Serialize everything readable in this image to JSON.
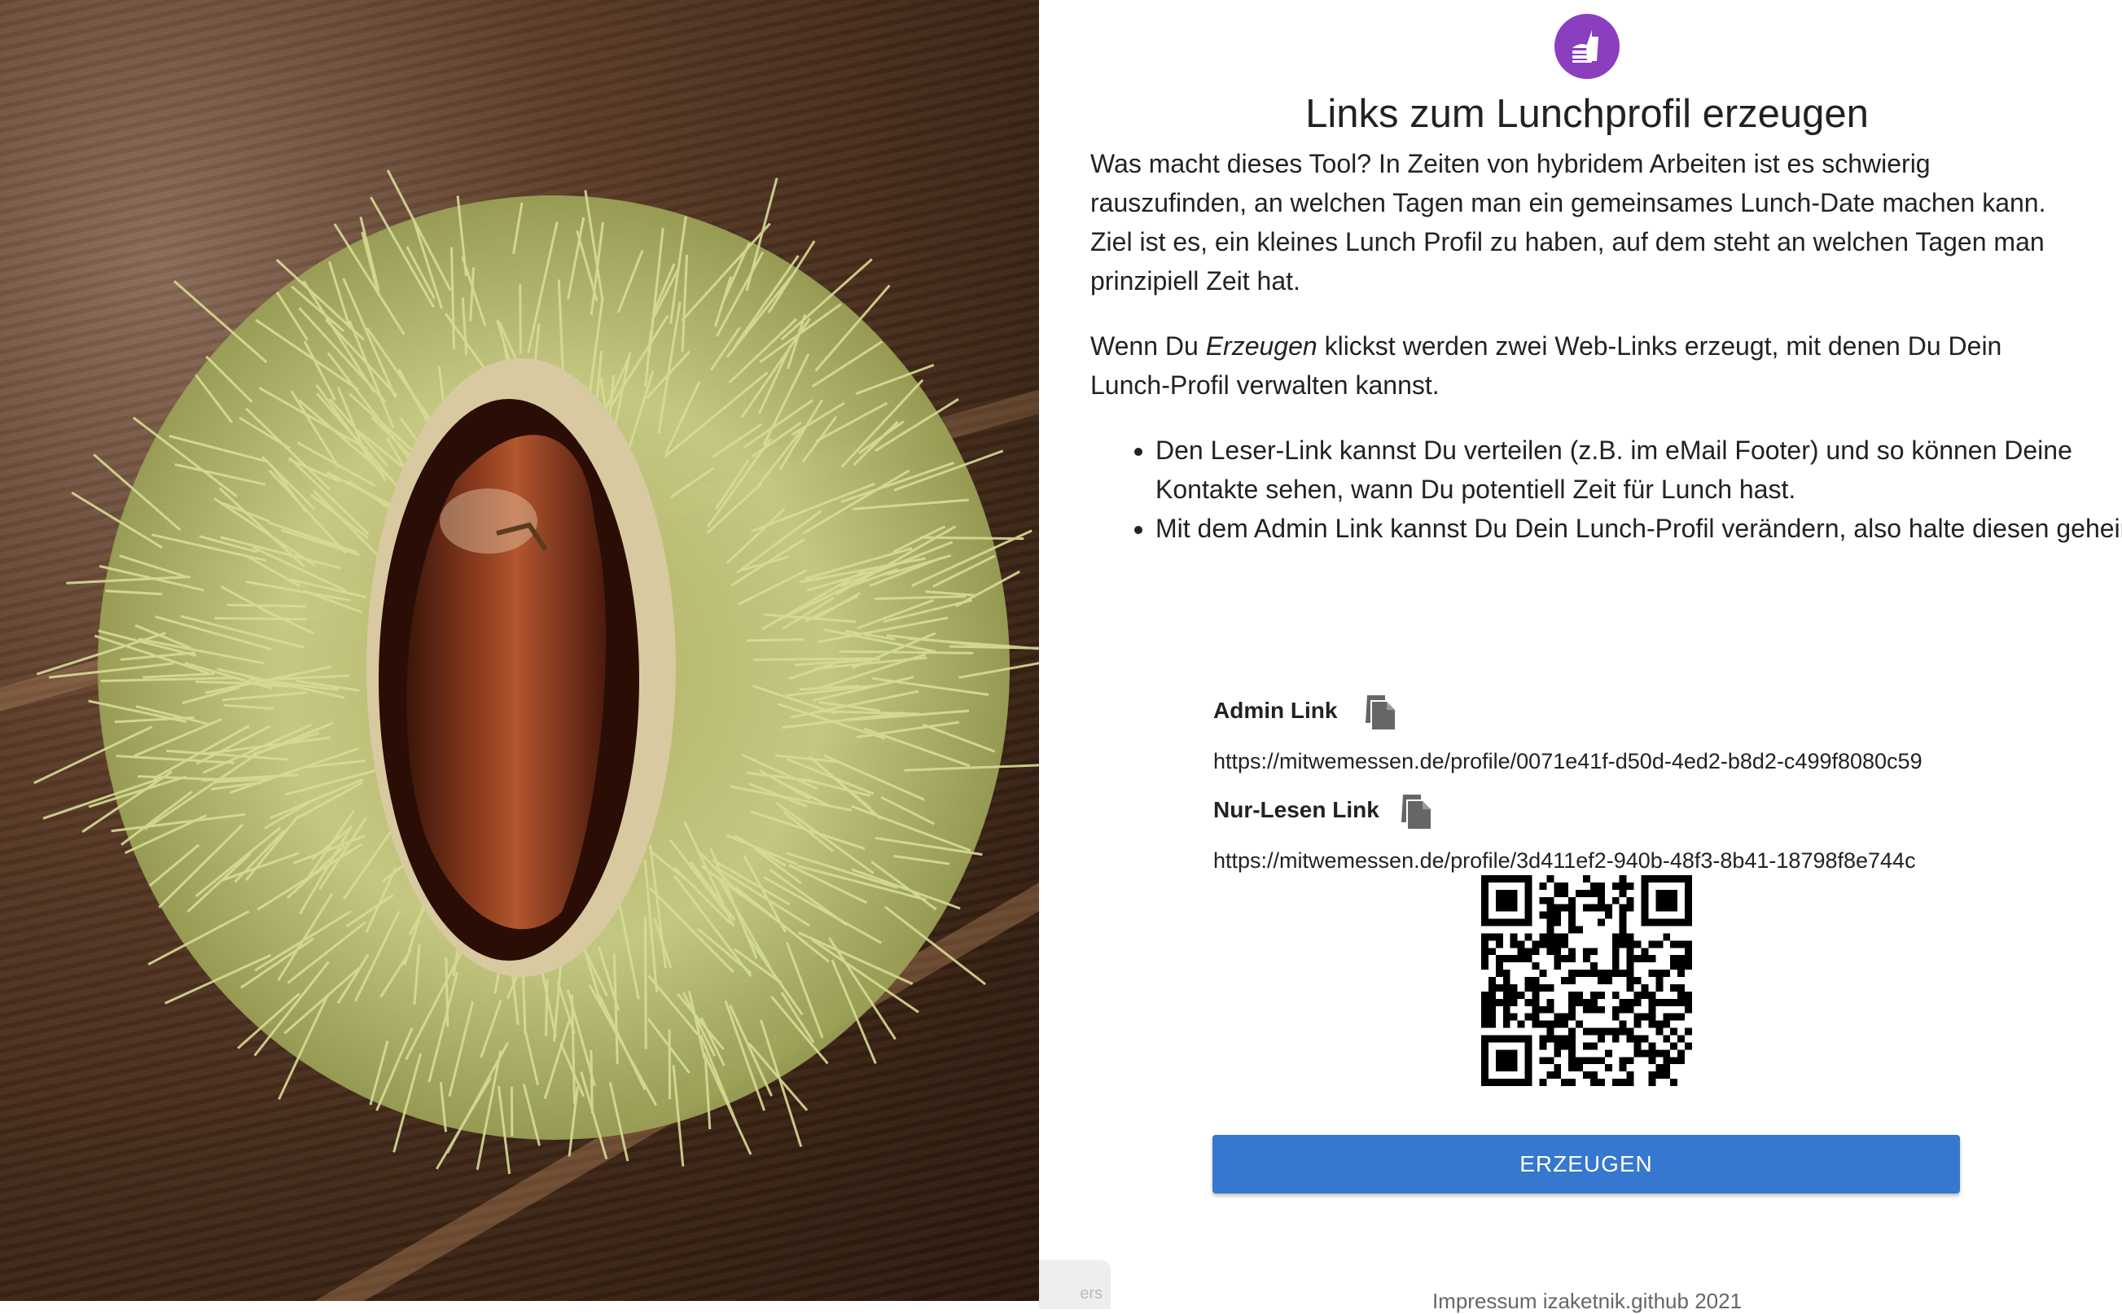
{
  "image": {
    "alt": "chestnut-in-spiky-husk-photo"
  },
  "header": {
    "title": "Links zum Lunchprofil erzeugen",
    "logo_icon": "lunch-food-icon",
    "logo_color": "#8b3fbf"
  },
  "intro": "Was macht dieses Tool? In Zeiten von hybridem Arbeiten ist es schwierig rauszufinden, an welchen Tagen man ein gemeinsames Lunch-Date machen kann. Ziel ist es, ein kleines Lunch Profil zu haben, auf dem steht an welchen Tagen man prinzipiell Zeit hat.",
  "paragraph2": {
    "before": "Wenn Du ",
    "emphasis": "Erzeugen",
    "after": " klickst werden zwei Web-Links erzeugt, mit denen Du Dein Lunch-Profil verwalten kannst."
  },
  "bullets": [
    "Den Leser-Link kannst Du verteilen (z.B. im eMail Footer) und so können Deine Kontakte sehen, wann Du potentiell Zeit für Lunch hast.",
    "Mit dem Admin Link kannst Du Dein Lunch-Profil verändern, also halte diesen geheim."
  ],
  "links": {
    "admin": {
      "label": "Admin Link",
      "url": "https://mitwemessen.de/profile/0071e41f-d50d-4ed2-b8d2-c499f8080c59",
      "icon": "copy-icon"
    },
    "readonly": {
      "label": "Nur-Lesen Link",
      "url": "https://mitwemessen.de/profile/3d411ef2-940b-48f3-8b41-18798f8e744c",
      "icon": "copy-icon"
    }
  },
  "qr": {
    "icon": "qr-code"
  },
  "actions": {
    "generate_label": "ERZEUGEN",
    "button_color": "#3677cf"
  },
  "footer": {
    "text": "Impressum izaketnik.github 2021"
  },
  "toast": {
    "text": "ers"
  }
}
